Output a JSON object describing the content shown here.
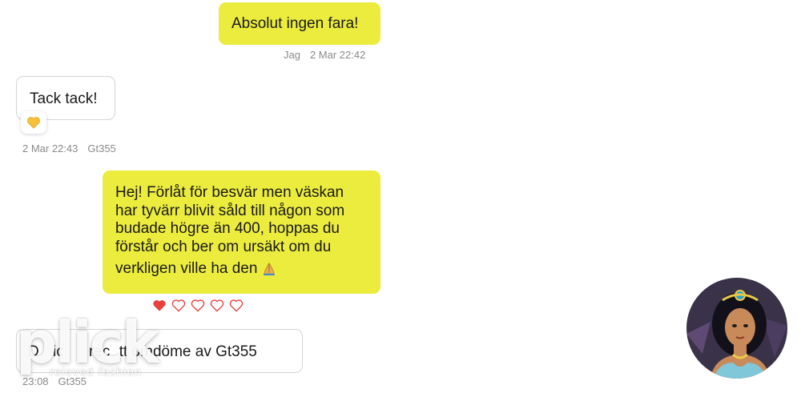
{
  "messages": [
    {
      "text": "Absolut ingen fara!",
      "sender": "Jag",
      "time": "2 Mar 22:42"
    },
    {
      "text": "Tack tack!",
      "sender": "Gt355",
      "time": "2 Mar 22:43",
      "reaction": "yellow-heart-icon"
    },
    {
      "lines": [
        "Hej! Förlåt för besvär men väskan",
        "har tyvärr blivit såld till någon som",
        "budade högre än 400, hoppas du",
        "förstår och ber om ursäkt om du",
        "verkligen ville ha den"
      ],
      "emoji": "folded-hands-icon"
    }
  ],
  "rating": {
    "filled": 1,
    "total": 5
  },
  "review_notice": {
    "text_start": "D",
    "text_mid": "ic",
    "text_mid2": "rec",
    "text_end": "tt omdöme av Gt355",
    "time": "23:08",
    "sender": "Gt355"
  },
  "watermark": {
    "logo": "plick",
    "tagline": "reloved fashion"
  },
  "colors": {
    "my_bubble": "#ecec3e",
    "heart": "#e8403c",
    "meta": "#8a8a8a"
  }
}
